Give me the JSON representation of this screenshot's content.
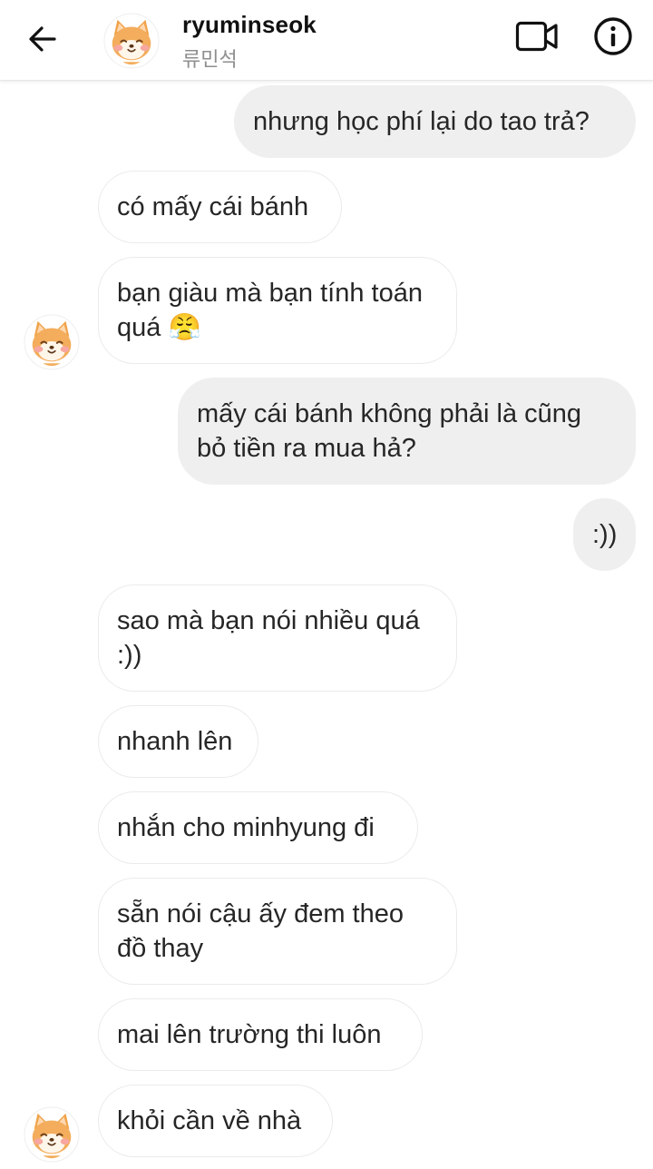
{
  "header": {
    "username": "ryuminseok",
    "subname": "류민석"
  },
  "icons": {
    "back": "arrow-left-icon",
    "video": "video-camera-icon",
    "info": "info-circle-icon",
    "avatar": "shiba-avatar-icon"
  },
  "colors": {
    "sent_bubble": "#efefef",
    "received_border": "#ebebeb",
    "secondary_text": "#8e8e8e"
  },
  "messages": [
    {
      "side": "sent",
      "text": "nhưng học phí lại do tao trả?"
    },
    {
      "side": "received",
      "text": "có mấy cái bánh"
    },
    {
      "side": "received",
      "text": "bạn giàu mà bạn tính toán quá 😤"
    },
    {
      "side": "sent",
      "text": "mấy cái bánh không phải là cũng bỏ tiền ra mua hả?"
    },
    {
      "side": "sent",
      "text": ":))"
    },
    {
      "side": "received",
      "text": "sao mà bạn nói nhiều quá :))"
    },
    {
      "side": "received",
      "text": "nhanh lên"
    },
    {
      "side": "received",
      "text": "nhắn cho minhyung đi"
    },
    {
      "side": "received",
      "text": "sẵn nói cậu ấy đem theo đồ thay"
    },
    {
      "side": "received",
      "text": "mai lên trường thi luôn"
    },
    {
      "side": "received",
      "text": "khỏi cần về nhà"
    }
  ]
}
